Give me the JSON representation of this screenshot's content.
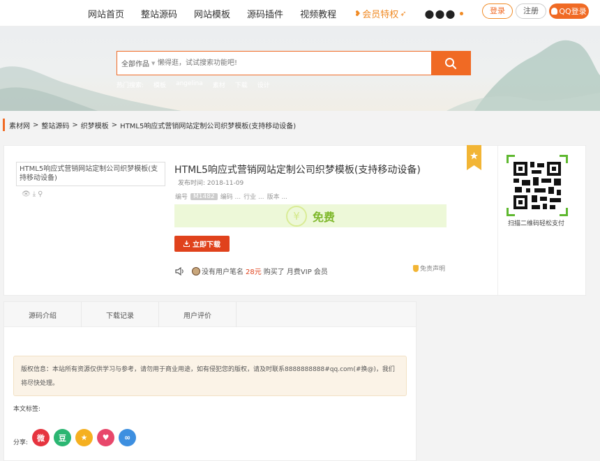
{
  "nav": {
    "items": [
      "网站首页",
      "整站源码",
      "网站模板",
      "源码插件",
      "视频教程"
    ],
    "vip_label": "会员特权",
    "more_label": "●●●",
    "login_label": "登录",
    "register_label": "注册",
    "qq_login_label": "QQ登录"
  },
  "search": {
    "category": "全部作品",
    "placeholder": "懒得逛，试试搜索功能吧!",
    "hot_label": "热门搜索:",
    "hot_terms": [
      "模板",
      "angelina",
      "素材",
      "下载",
      "设计"
    ]
  },
  "breadcrumb": [
    "素材网",
    ">",
    "整站源码",
    ">",
    "织梦模板",
    ">",
    "HTML5响应式营销网站定制公司织梦模板(支持移动设备)"
  ],
  "product": {
    "thumb_alt": "HTML5响应式营销网站定制公司织梦模板(支持移动设备)",
    "title": "HTML5响应式营销网站定制公司织梦模板(支持移动设备)",
    "pub_label": "发布时间:",
    "pub_date": "2018-11-09",
    "code_label": "编号",
    "code_value": "M1482",
    "coding_label": "编码 ...",
    "industry_label": "行业 ...",
    "version_label": "版本 ...",
    "price_symbol": "¥",
    "price_label": "免费",
    "download_label": "立即下载",
    "buyer_text": "没有用户笔名",
    "amount": "28元",
    "bought_text": "购买了 月费VIP 会员",
    "disclaimer": "免责声明",
    "qr_caption": "扫描二维码轻松支付"
  },
  "tabs": [
    "源码介绍",
    "下载记录",
    "用户评价"
  ],
  "notice": "版权信息：本站所有资源仅供学习与参考，请勿用于商业用途，如有侵犯您的版权，请及时联系8888888888#qq.com(#换@)，我们将尽快处理。",
  "tags_label": "本文标签:",
  "share_label": "分享:",
  "share_icons": [
    {
      "name": "weibo-icon",
      "glyph": "微",
      "color": "#e6343f"
    },
    {
      "name": "douban-icon",
      "glyph": "豆",
      "color": "#2bb672"
    },
    {
      "name": "qzone-icon",
      "glyph": "★",
      "color": "#f5b020"
    },
    {
      "name": "pocket-icon",
      "glyph": "♥",
      "color": "#e8476b"
    },
    {
      "name": "link-icon",
      "glyph": "∞",
      "color": "#3d8fe0"
    }
  ],
  "colors": {
    "accent": "#f06a24",
    "download": "#e0421c",
    "free_green": "#7fb82c"
  }
}
